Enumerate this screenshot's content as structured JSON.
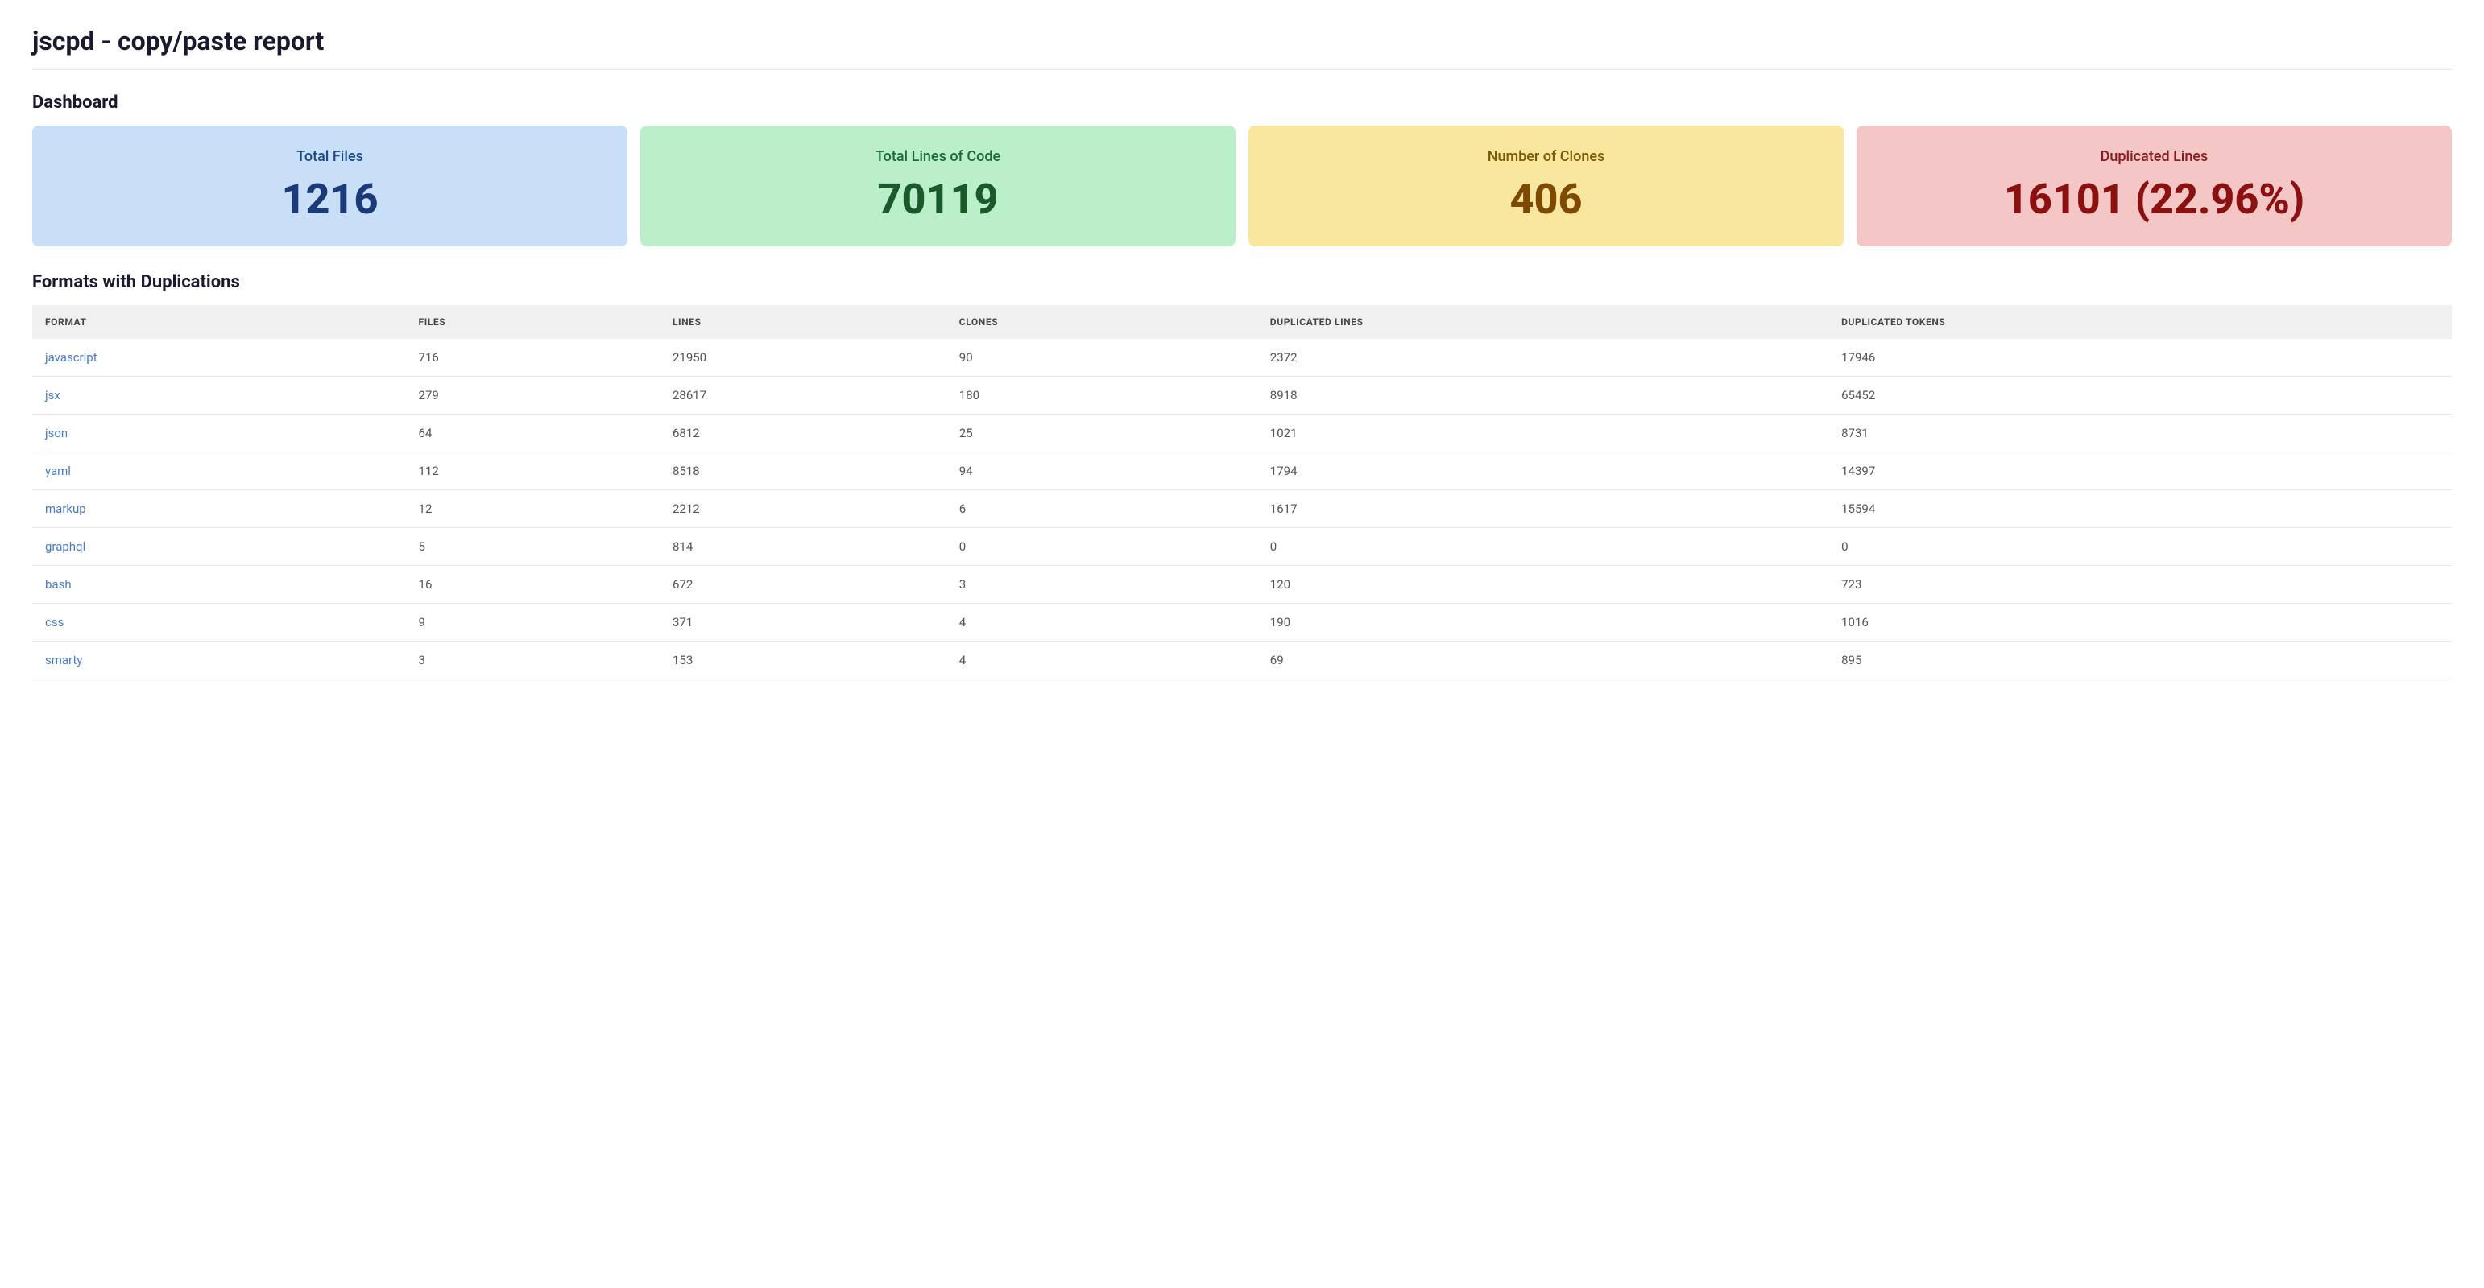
{
  "page": {
    "title": "jscpd - copy/paste report"
  },
  "dashboard": {
    "section_title": "Dashboard",
    "stats": [
      {
        "id": "total-files",
        "label": "Total Files",
        "value": "1216",
        "color": "blue"
      },
      {
        "id": "total-lines",
        "label": "Total Lines of Code",
        "value": "70119",
        "color": "green"
      },
      {
        "id": "num-clones",
        "label": "Number of Clones",
        "value": "406",
        "color": "yellow"
      },
      {
        "id": "dup-lines",
        "label": "Duplicated Lines",
        "value": "16101 (22.96%)",
        "color": "red"
      }
    ]
  },
  "formats": {
    "section_title": "Formats with Duplications",
    "columns": [
      "FORMAT",
      "FILES",
      "LINES",
      "CLONES",
      "DUPLICATED LINES",
      "DUPLICATED TOKENS"
    ],
    "rows": [
      {
        "format": "javascript",
        "files": "716",
        "lines": "21950",
        "clones": "90",
        "duplicated_lines": "2372",
        "duplicated_tokens": "17946"
      },
      {
        "format": "jsx",
        "files": "279",
        "lines": "28617",
        "clones": "180",
        "duplicated_lines": "8918",
        "duplicated_tokens": "65452"
      },
      {
        "format": "json",
        "files": "64",
        "lines": "6812",
        "clones": "25",
        "duplicated_lines": "1021",
        "duplicated_tokens": "8731"
      },
      {
        "format": "yaml",
        "files": "112",
        "lines": "8518",
        "clones": "94",
        "duplicated_lines": "1794",
        "duplicated_tokens": "14397"
      },
      {
        "format": "markup",
        "files": "12",
        "lines": "2212",
        "clones": "6",
        "duplicated_lines": "1617",
        "duplicated_tokens": "15594"
      },
      {
        "format": "graphql",
        "files": "5",
        "lines": "814",
        "clones": "0",
        "duplicated_lines": "0",
        "duplicated_tokens": "0"
      },
      {
        "format": "bash",
        "files": "16",
        "lines": "672",
        "clones": "3",
        "duplicated_lines": "120",
        "duplicated_tokens": "723"
      },
      {
        "format": "css",
        "files": "9",
        "lines": "371",
        "clones": "4",
        "duplicated_lines": "190",
        "duplicated_tokens": "1016"
      },
      {
        "format": "smarty",
        "files": "3",
        "lines": "153",
        "clones": "4",
        "duplicated_lines": "69",
        "duplicated_tokens": "895"
      }
    ]
  }
}
